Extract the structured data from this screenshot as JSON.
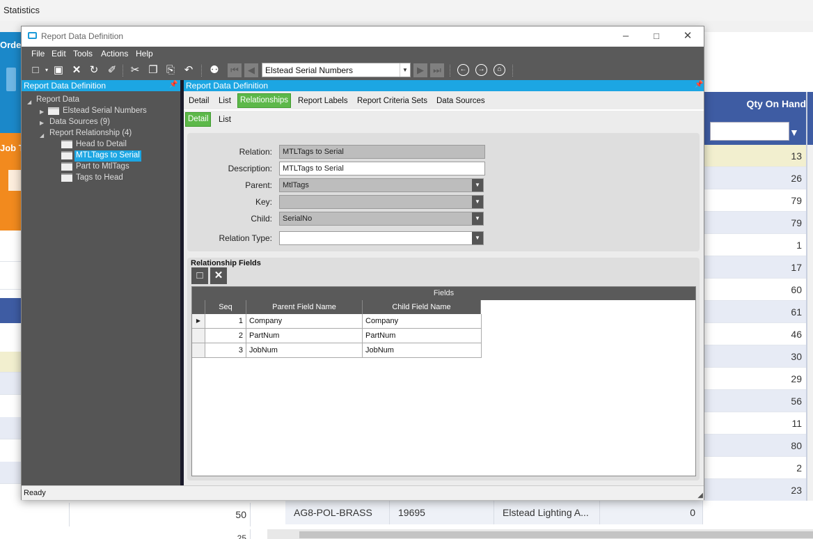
{
  "background": {
    "title": "Statistics",
    "order_label": "Orde",
    "job_label": "Job T",
    "qty_header": "Qty On Hand",
    "qty_values": [
      "13",
      "26",
      "79",
      "79",
      "1",
      "17",
      "60",
      "61",
      "46",
      "30",
      "29",
      "56",
      "11",
      "80",
      "2",
      "23",
      "11"
    ],
    "bottom_row": {
      "part": "AG8-POL-BRASS",
      "number": "19695",
      "company": "Elstead Lighting A...",
      "qty": "0",
      "left_value": "50",
      "left_value_2": "25"
    }
  },
  "dialog": {
    "title": "Report Data Definition",
    "menu": [
      "File",
      "Edit",
      "Tools",
      "Actions",
      "Help"
    ],
    "toolbar_combo": "Elstead Serial Numbers",
    "tree_header": "Report Data Definition",
    "tree": {
      "root": "Report Data",
      "n1": "Elstead Serial Numbers",
      "n2": "Data Sources (9)",
      "n3": "Report Relationship (4)",
      "c1": "Head to Detail",
      "c2": "MTLTags to Serial",
      "c3": "Part to MtlTags",
      "c4": "Tags to Head"
    },
    "content_header": "Report Data Definition",
    "tabs": [
      "Detail",
      "List",
      "Relationships",
      "Report Labels",
      "Report Criteria Sets",
      "Data Sources"
    ],
    "subtabs": [
      "Detail",
      "List"
    ],
    "form": {
      "relation_label": "Relation:",
      "relation": "MTLTags to Serial",
      "description_label": "Description:",
      "description": "MTLTags to Serial",
      "parent_label": "Parent:",
      "parent": "MtlTags",
      "key_label": "Key:",
      "key": "",
      "child_label": "Child:",
      "child": "SerialNo",
      "relation_type_label": "Relation Type:",
      "relation_type": ""
    },
    "relationship_fields": {
      "title": "Relationship Fields",
      "group_header": "Fields",
      "columns": [
        "Seq",
        "Parent Field Name",
        "Child Field Name"
      ],
      "rows": [
        {
          "seq": "1",
          "parent": "Company",
          "child": "Company"
        },
        {
          "seq": "2",
          "parent": "PartNum",
          "child": "PartNum"
        },
        {
          "seq": "3",
          "parent": "JobNum",
          "child": "JobNum"
        }
      ]
    },
    "status": "Ready"
  },
  "colors": {
    "accent_blue": "#1ca6e3",
    "active_tab_green": "#5db84a",
    "dark_chrome": "#5a5a5a",
    "bg_header_blue": "#3e5ca3",
    "order_tile": "#1b88c9",
    "job_tile": "#f28a1e"
  },
  "icons": [
    "new-icon",
    "save-icon",
    "delete-icon",
    "refresh-icon",
    "clear-icon",
    "cut-icon",
    "copy-icon",
    "paste-icon",
    "undo-icon",
    "binoculars-icon",
    "first-icon",
    "prev-icon",
    "next-icon",
    "last-icon",
    "back-icon",
    "forward-icon",
    "home-icon",
    "pin-icon",
    "folder-icon",
    "filter-icon"
  ]
}
